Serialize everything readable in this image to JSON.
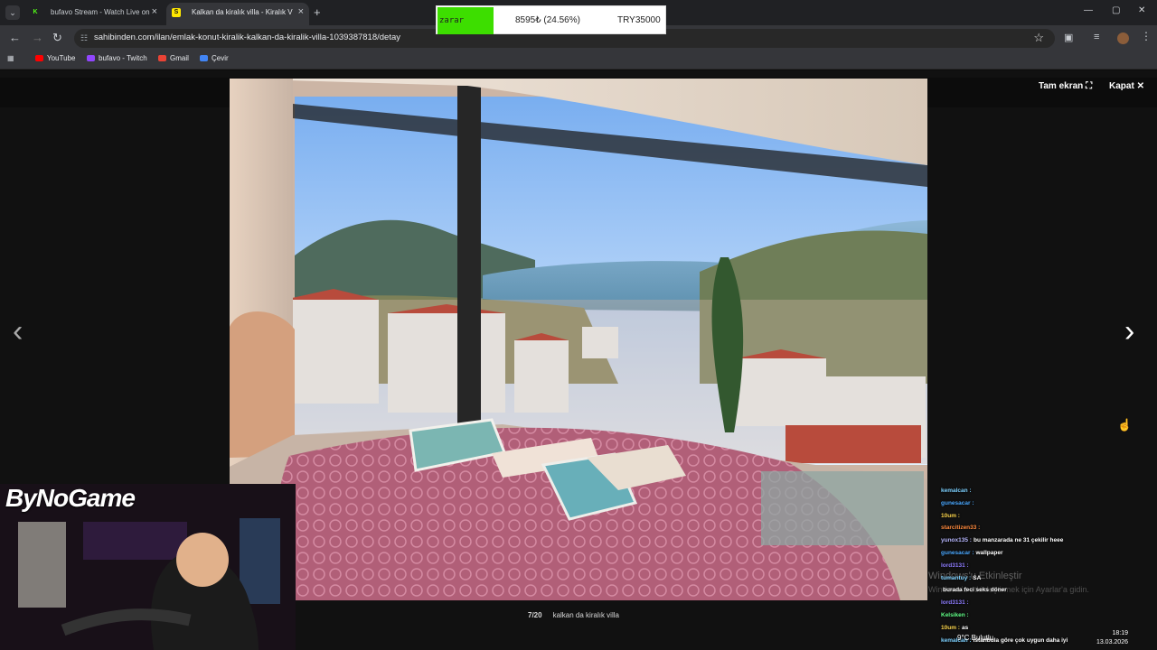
{
  "browser": {
    "tabs": [
      {
        "label": "bufavo Stream - Watch Live on",
        "icon": "K"
      },
      {
        "label": "Kalkan da kiralık villa - Kiralık V",
        "icon": "S"
      }
    ],
    "url": "sahibinden.com/ilan/emlak-konut-kiralik-kalkan-da-kiralik-villa-1039387818/detay",
    "bookmarks": [
      "YouTube",
      "bufavo - Twitch",
      "Gmail",
      "Çevir"
    ]
  },
  "gallery": {
    "fullscreen_label": "Tam ekran",
    "close_label": "Kapat",
    "counter": "7/20",
    "caption": "kalkan da kiralık villa"
  },
  "overlay": {
    "ticker_status": "zarar",
    "ticker_change": "8595₺ (24.56%)",
    "ticker_price": "TRY35000",
    "brand": "ByNoGame"
  },
  "chat": [
    {
      "user": "kemalcan",
      "message": "",
      "color": "#7dd1ff"
    },
    {
      "user": "gunesacar",
      "message": "",
      "color": "#4aa8ff"
    },
    {
      "user": "10um",
      "message": "",
      "color": "#ffd84d"
    },
    {
      "user": "starcitizen33",
      "message": "",
      "color": "#ff8a3d"
    },
    {
      "user": "yunox135",
      "message": "bu manzarada ne 31 çekilir heee",
      "color": "#b8b8ff"
    },
    {
      "user": "gunesacar",
      "message": "wallpaper",
      "color": "#4aa8ff"
    },
    {
      "user": "lord3131",
      "message": "",
      "color": "#8f7dff"
    },
    {
      "user": "tumantuy",
      "message": "SA",
      "color": "#7dd1ff"
    },
    {
      "user": "",
      "message": "burada feci seks döner",
      "color": "#7dd1ff"
    },
    {
      "user": "lord3131",
      "message": "",
      "color": "#8f7dff"
    },
    {
      "user": "Kelsiken",
      "message": "",
      "color": "#62ff88"
    },
    {
      "user": "10um",
      "message": "as",
      "color": "#ffd84d"
    },
    {
      "user": "kemalcan",
      "message": "istanbula göre çok uygun daha iyi",
      "color": "#7dd1ff"
    }
  ],
  "windows_watermark": {
    "title": "Windows'u Etkinleştir",
    "subtitle": "Windows'u etkinleştirmek için Ayarlar'a gidin."
  },
  "taskbar": {
    "weather": "9°C  Bulutlu",
    "time": "18:19",
    "date": "13.03.2026"
  }
}
